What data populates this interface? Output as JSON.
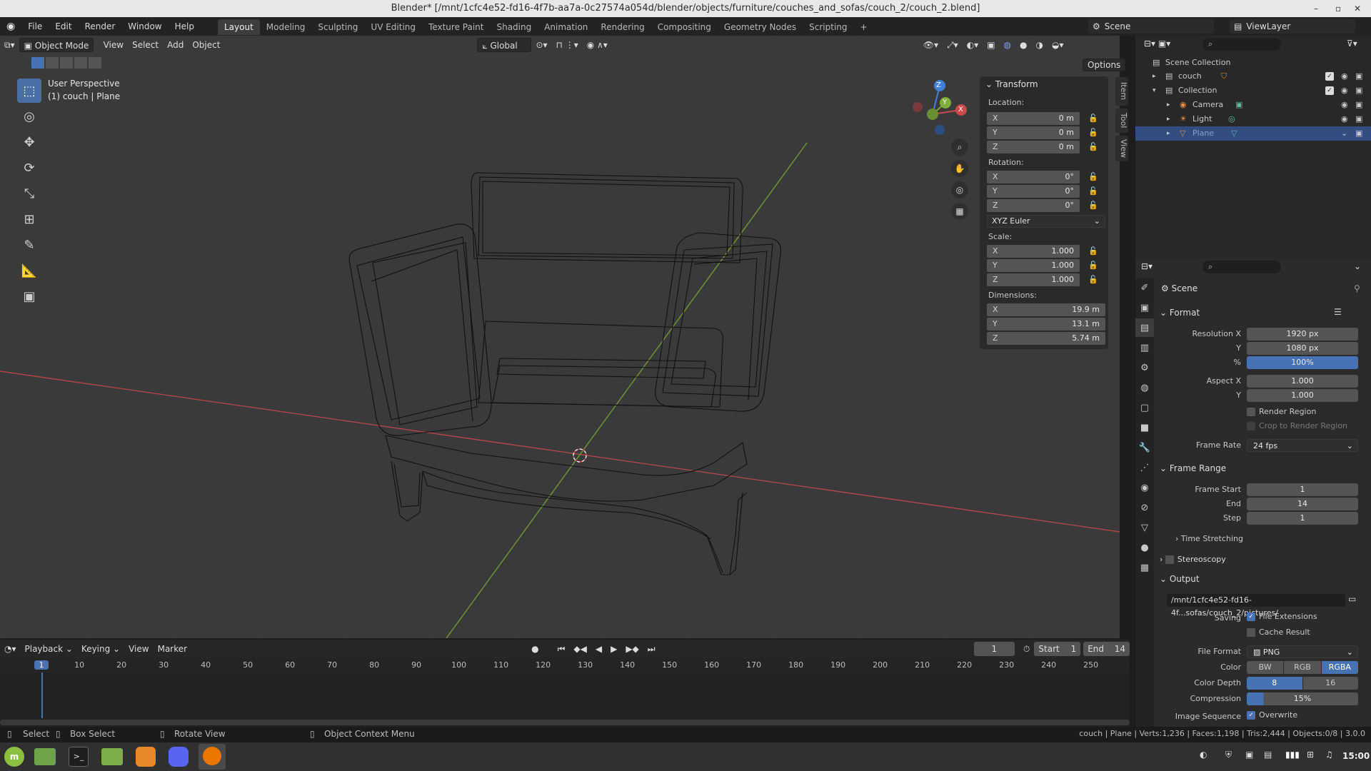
{
  "window": {
    "title": "Blender* [/mnt/1cfc4e52-fd16-4f7b-aa7a-0c27574a054d/blender/objects/furniture/couches_and_sofas/couch_2/couch_2.blend]"
  },
  "menu": {
    "items": [
      "File",
      "Edit",
      "Render",
      "Window",
      "Help"
    ],
    "workspaces": [
      "Layout",
      "Modeling",
      "Sculpting",
      "UV Editing",
      "Texture Paint",
      "Shading",
      "Animation",
      "Rendering",
      "Compositing",
      "Geometry Nodes",
      "Scripting"
    ],
    "add_tab": "+",
    "scene": "Scene",
    "view_layer": "ViewLayer"
  },
  "viewport_header": {
    "mode": "Object Mode",
    "menus": [
      "View",
      "Select",
      "Add",
      "Object"
    ],
    "orientation": "Global",
    "options": "Options"
  },
  "viewport": {
    "perspective": "User Perspective",
    "object_info": "(1) couch | Plane",
    "gizmo": {
      "x": "X",
      "y": "Y",
      "z": "Z"
    }
  },
  "npanel": {
    "section": "Transform",
    "location_label": "Location:",
    "location": [
      {
        "axis": "X",
        "value": "0 m"
      },
      {
        "axis": "Y",
        "value": "0 m"
      },
      {
        "axis": "Z",
        "value": "0 m"
      }
    ],
    "rotation_label": "Rotation:",
    "rotation": [
      {
        "axis": "X",
        "value": "0°"
      },
      {
        "axis": "Y",
        "value": "0°"
      },
      {
        "axis": "Z",
        "value": "0°"
      }
    ],
    "rotation_mode": "XYZ Euler",
    "scale_label": "Scale:",
    "scale": [
      {
        "axis": "X",
        "value": "1.000"
      },
      {
        "axis": "Y",
        "value": "1.000"
      },
      {
        "axis": "Z",
        "value": "1.000"
      }
    ],
    "dimensions_label": "Dimensions:",
    "dimensions": [
      {
        "axis": "X",
        "value": "19.9 m"
      },
      {
        "axis": "Y",
        "value": "13.1 m"
      },
      {
        "axis": "Z",
        "value": "5.74 m"
      }
    ],
    "tabs": [
      "Item",
      "Tool",
      "View"
    ]
  },
  "timeline": {
    "menus": [
      "Playback",
      "Keying",
      "View",
      "Marker"
    ],
    "current_frame": "1",
    "start_label": "Start",
    "start": "1",
    "end_label": "End",
    "end": "14",
    "ruler": [
      "1",
      "10",
      "20",
      "30",
      "40",
      "50",
      "60",
      "70",
      "80",
      "90",
      "100",
      "110",
      "120",
      "130",
      "140",
      "150",
      "160",
      "170",
      "180",
      "190",
      "200",
      "210",
      "220",
      "230",
      "240",
      "250"
    ]
  },
  "statusbar": {
    "select": "Select",
    "box_select": "Box Select",
    "rotate_view": "Rotate View",
    "context_menu": "Object Context Menu",
    "stats": "couch | Plane | Verts:1,236 | Faces:1,198 | Tris:2,444 | Objects:0/8 | 3.0.0"
  },
  "outliner": {
    "root": "Scene Collection",
    "items": [
      {
        "label": "couch",
        "depth": 0
      },
      {
        "label": "Collection",
        "depth": 0
      },
      {
        "label": "Camera",
        "depth": 1
      },
      {
        "label": "Light",
        "depth": 1
      },
      {
        "label": "Plane",
        "depth": 1
      }
    ]
  },
  "properties": {
    "context": "Scene",
    "format": {
      "title": "Format",
      "resolution_x_label": "Resolution X",
      "resolution_x": "1920 px",
      "y_label": "Y",
      "resolution_y": "1080 px",
      "pct_label": "%",
      "percent": "100%",
      "aspect_x_label": "Aspect X",
      "aspect_x": "1.000",
      "aspect_y_label": "Y",
      "aspect_y": "1.000",
      "render_region": "Render Region",
      "crop": "Crop to Render Region",
      "frame_rate_label": "Frame Rate",
      "frame_rate": "24 fps"
    },
    "frame_range": {
      "title": "Frame Range",
      "start_label": "Frame Start",
      "start": "1",
      "end_label": "End",
      "end": "14",
      "step_label": "Step",
      "step": "1",
      "time_stretching": "Time Stretching"
    },
    "stereoscopy": "Stereoscopy",
    "output": {
      "title": "Output",
      "path": "/mnt/1cfc4e52-fd16-4f...sofas/couch_2/pictures/",
      "saving_label": "Saving",
      "file_extensions": "File Extensions",
      "cache_result": "Cache Result",
      "file_format_label": "File Format",
      "file_format": "PNG",
      "color_label": "Color",
      "color_options": [
        "BW",
        "RGB",
        "RGBA"
      ],
      "color_depth_label": "Color Depth",
      "color_depth": [
        "8",
        "16"
      ],
      "compression_label": "Compression",
      "compression": "15%",
      "image_sequence_label": "Image Sequence",
      "overwrite": "Overwrite"
    }
  },
  "taskbar": {
    "time": "15:00"
  },
  "colors": {
    "accent": "#4772b3",
    "x_axis": "#c84a4a",
    "y_axis": "#7fae3a",
    "z_axis": "#3f7fd6"
  }
}
